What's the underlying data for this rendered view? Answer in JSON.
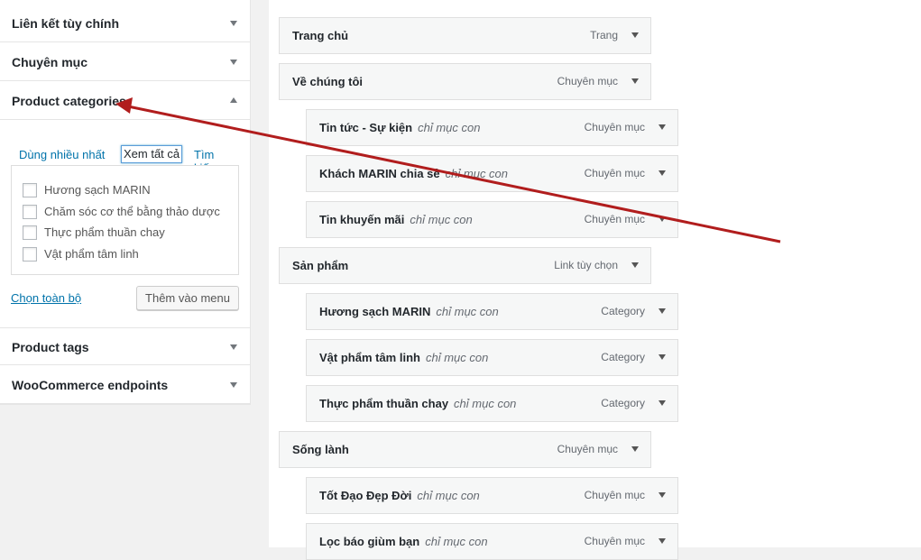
{
  "accordion": {
    "custom_links": "Liên kết tùy chính",
    "categories": "Chuyên mục",
    "product_categories": "Product categories",
    "product_tags": "Product tags",
    "woo_endpoints": "WooCommerce endpoints"
  },
  "product_categories_panel": {
    "tabs": {
      "most_used": "Dùng nhiều nhất",
      "view_all": "Xem tất cả",
      "search": "Tìm kiếm"
    },
    "items": [
      "Hương sạch MARIN",
      "Chăm sóc cơ thể bằng thảo dược",
      "Thực phẩm thuần chay",
      "Vật phẩm tâm linh"
    ],
    "select_all": "Chọn toàn bộ",
    "add_to_menu": "Thêm vào menu"
  },
  "menu_items": [
    {
      "title": "Trang chủ",
      "sub": "",
      "type": "Trang"
    },
    {
      "title": "Về chúng tôi",
      "sub": "",
      "type": "Chuyên mục"
    },
    {
      "title": "Tin tức - Sự kiện",
      "sub": "chỉ mục con",
      "type": "Chuyên mục"
    },
    {
      "title": "Khách MARIN chia sẻ",
      "sub": "chỉ mục con",
      "type": "Chuyên mục"
    },
    {
      "title": "Tin khuyến mãi",
      "sub": "chỉ mục con",
      "type": "Chuyên mục"
    },
    {
      "title": "Sản phẩm",
      "sub": "",
      "type": "Link tùy chọn"
    },
    {
      "title": "Hương sạch MARIN",
      "sub": "chỉ mục con",
      "type": "Category"
    },
    {
      "title": "Vật phẩm tâm linh",
      "sub": "chỉ mục con",
      "type": "Category"
    },
    {
      "title": "Thực phẩm thuần chay",
      "sub": "chỉ mục con",
      "type": "Category"
    },
    {
      "title": "Sống lành",
      "sub": "",
      "type": "Chuyên mục"
    },
    {
      "title": "Tốt Đạo Đẹp Đời",
      "sub": "chỉ mục con",
      "type": "Chuyên mục"
    },
    {
      "title": "Lọc báo giùm bạn",
      "sub": "chỉ mục con",
      "type": "Chuyên mục"
    }
  ],
  "colors": {
    "link": "#0073aa",
    "annotation_arrow": "#b11d1d"
  }
}
